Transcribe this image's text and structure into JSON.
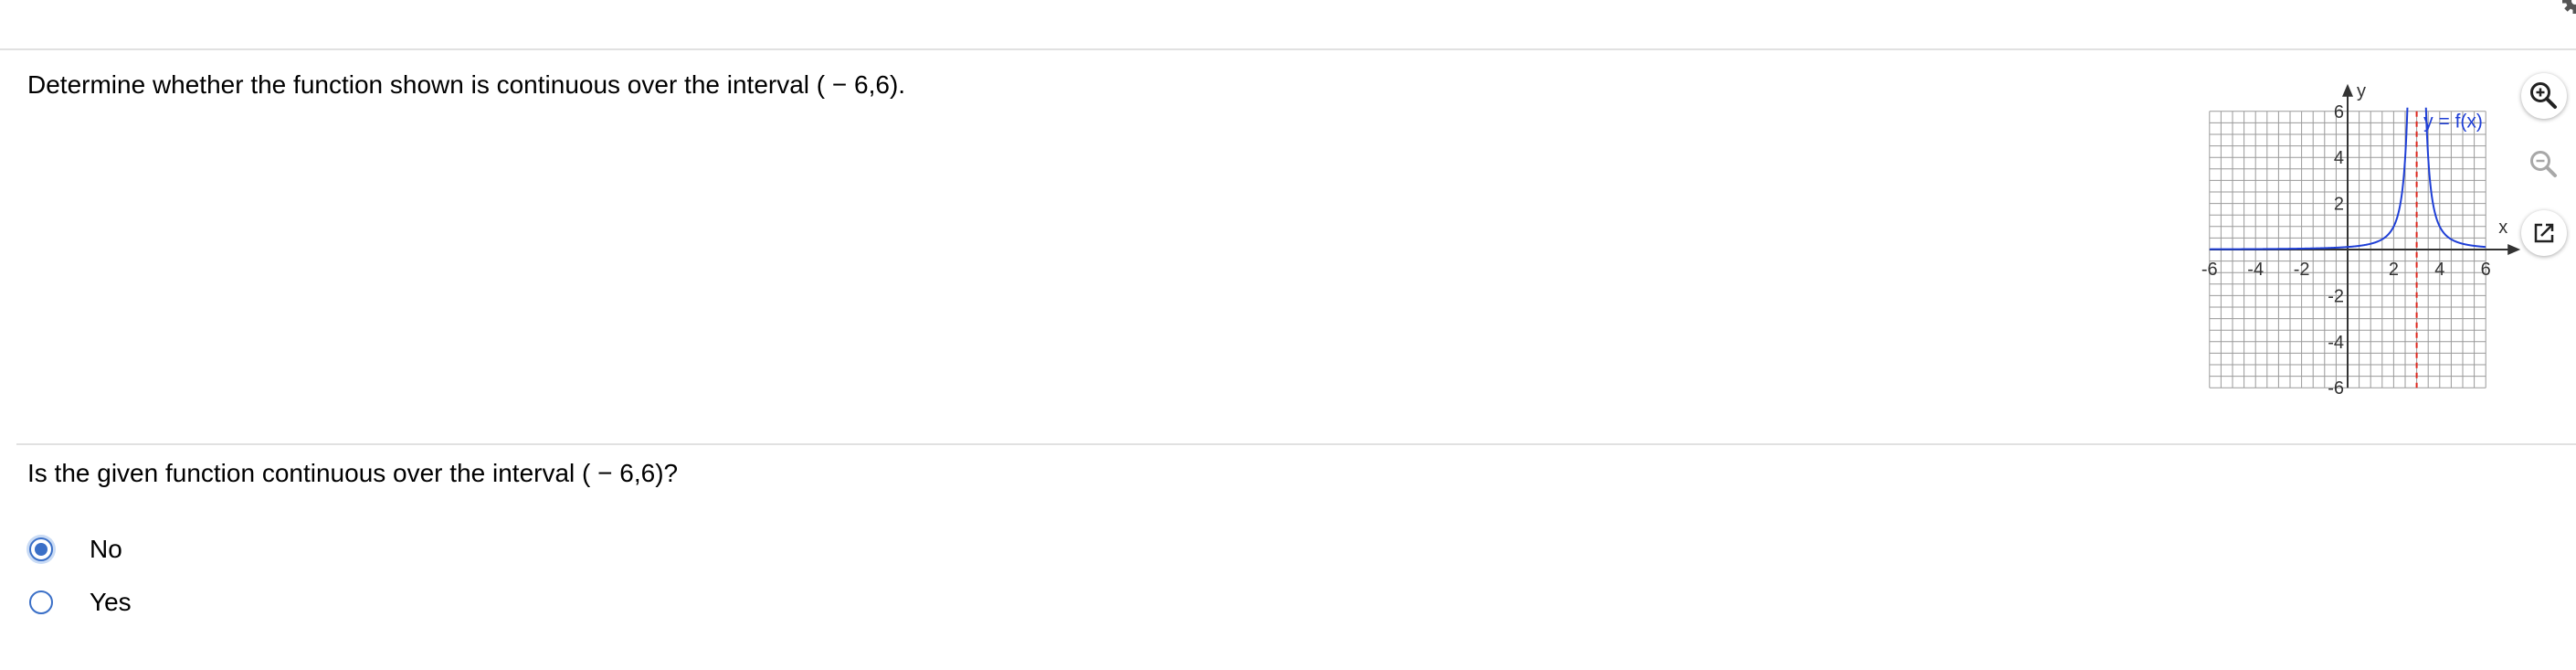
{
  "question": {
    "text": "Determine whether the function shown is continuous over the interval ( − 6,6)."
  },
  "prompt": {
    "text": "Is the given function continuous over the interval ( − 6,6)?"
  },
  "options": [
    {
      "label": "No",
      "selected": true
    },
    {
      "label": "Yes",
      "selected": false
    }
  ],
  "graph": {
    "function_label": "y = f(x)",
    "x_axis_label": "x",
    "y_axis_label": "y",
    "x_ticks": [
      "-6",
      "-4",
      "-2",
      "2",
      "4",
      "6"
    ],
    "y_ticks": [
      "6",
      "4",
      "2",
      "-2",
      "-4",
      "-6"
    ],
    "curve_color": "#1f3fd6",
    "asymptote_color": "#e0281e",
    "asymptote_x": 3
  },
  "tools": {
    "zoom_in": "zoom-in-icon",
    "zoom_out": "zoom-out-icon",
    "popout": "popout-icon"
  },
  "colors": {
    "accent": "#3a6fc7",
    "rule": "#e1e1e1",
    "grid": "#9a9a9a"
  }
}
